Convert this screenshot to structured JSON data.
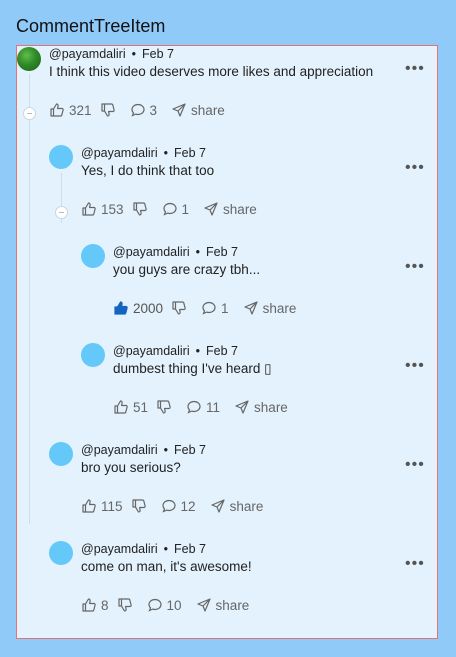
{
  "title": "CommentTreeItem",
  "share_label": "share",
  "comments": [
    {
      "author": "@payamdaliri",
      "date": "Feb 7",
      "text": "I think this video deserves more likes and appreciation",
      "likes": "321",
      "replies": "3",
      "avatar": "watermelon"
    },
    {
      "author": "@payamdaliri",
      "date": "Feb 7",
      "text": "Yes, I do think that too",
      "likes": "153",
      "replies": "1",
      "avatar": "blue"
    },
    {
      "author": "@payamdaliri",
      "date": "Feb 7",
      "text": "you guys are crazy tbh...",
      "likes": "2000",
      "replies": "1",
      "avatar": "blue",
      "liked": true
    },
    {
      "author": "@payamdaliri",
      "date": "Feb 7",
      "text": "dumbest thing I've heard ▯",
      "likes": "51",
      "replies": "11",
      "avatar": "blue"
    },
    {
      "author": "@payamdaliri",
      "date": "Feb 7",
      "text": "bro you serious?",
      "likes": "115",
      "replies": "12",
      "avatar": "blue"
    },
    {
      "author": "@payamdaliri",
      "date": "Feb 7",
      "text": "come on man, it's awesome!",
      "likes": "8",
      "replies": "10",
      "avatar": "blue"
    }
  ],
  "colors": {
    "page": "#90CAF9",
    "panel": "#E3F2FD",
    "frame_border": "#E57373",
    "avatar": "#64C8F8",
    "liked": "#1565C0"
  }
}
